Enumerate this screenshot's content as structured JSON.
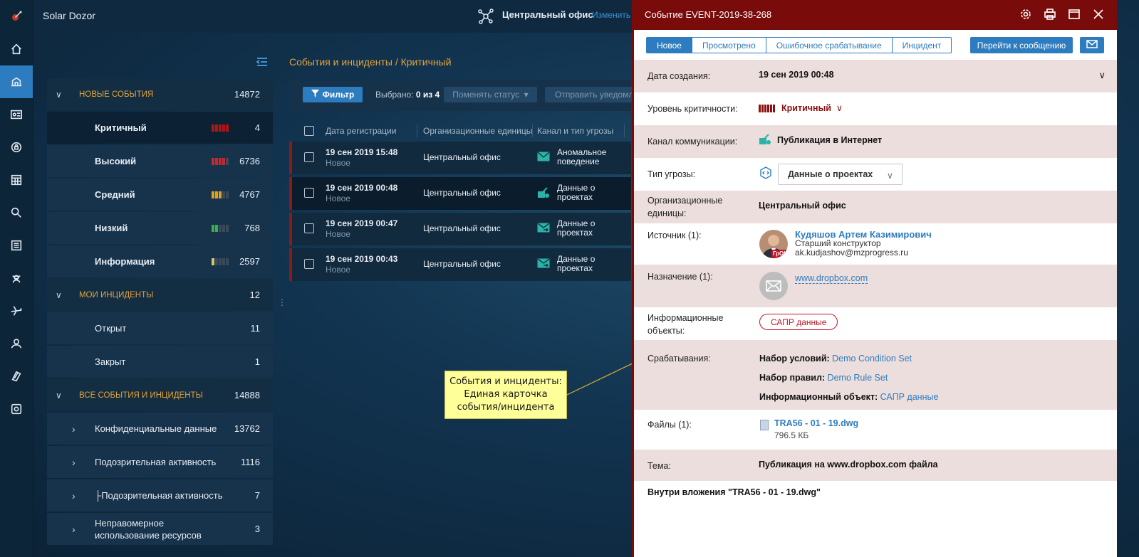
{
  "app": {
    "title": "Solar Dozor",
    "office": "Центральный офис",
    "change_label": "Изменить"
  },
  "sidebar_icons": [
    "home-icon",
    "dashboard-icon",
    "id-card-icon",
    "security-icon",
    "calendar-icon",
    "search-icon",
    "list-icon",
    "agent-icon",
    "plane-icon",
    "users-icon",
    "archive-icon",
    "settings-icon"
  ],
  "tree": {
    "new_events": {
      "label": "НОВЫЕ СОБЫТИЯ",
      "count": "14872",
      "items": [
        {
          "label": "Критичный",
          "count": "4"
        },
        {
          "label": "Высокий",
          "count": "6736"
        },
        {
          "label": "Средний",
          "count": "4767"
        },
        {
          "label": "Низкий",
          "count": "768"
        },
        {
          "label": "Информация",
          "count": "2597"
        }
      ]
    },
    "my_incidents": {
      "label": "МОИ ИНЦИДЕНТЫ",
      "count": "12",
      "items": [
        {
          "label": "Открыт",
          "count": "11"
        },
        {
          "label": "Закрыт",
          "count": "1"
        }
      ]
    },
    "all": {
      "label": "ВСЕ СОБЫТИЯ И ИНЦИДЕНТЫ",
      "count": "14888",
      "items": [
        {
          "label": "Конфиденциальные данные",
          "count": "13762"
        },
        {
          "label": "Подозрительная активность",
          "count": "1116"
        },
        {
          "label": "├Подозрительная активность",
          "count": "7"
        },
        {
          "label": "Неправомерное использование ресурсов",
          "count": "3"
        }
      ]
    }
  },
  "main": {
    "breadcrumb": "События и инциденты / Критичный",
    "filter_label": "Фильтр",
    "selected_label": "Выбрано:",
    "selected_value": "0 из 4",
    "change_status_label": "Поменять статус",
    "send_notify_label": "Отправить уведомление",
    "columns": [
      "Дата регистрации",
      "Организационные единицы",
      "Канал и тип угрозы"
    ],
    "rows": [
      {
        "date": "19 сен 2019 15:48",
        "status": "Новое",
        "org": "Центральный офис",
        "threat": "Аномальное поведение"
      },
      {
        "date": "19 сен 2019 00:48",
        "status": "Новое",
        "org": "Центральный офис",
        "threat": "Данные о проектах"
      },
      {
        "date": "19 сен 2019 00:47",
        "status": "Новое",
        "org": "Центральный офис",
        "threat": "Данные о проектах"
      },
      {
        "date": "19 сен 2019 00:43",
        "status": "Новое",
        "org": "Центральный офис",
        "threat": "Данные о проектах"
      }
    ]
  },
  "callout": {
    "line1": "События и инциденты:",
    "line2": "Единая карточка",
    "line3": "события/инцидента"
  },
  "panel": {
    "title": "Событие EVENT-2019-38-268",
    "tabs": [
      "Новое",
      "Просмотрено",
      "Ошибочное срабатывание",
      "Инцидент"
    ],
    "goto_label": "Перейти к сообщению",
    "created_label": "Дата создания:",
    "created_value": "19 сен 2019 00:48",
    "severity_label": "Уровень критичности:",
    "severity_value": "Критичный",
    "channel_label": "Канал коммуникации:",
    "channel_value": "Публикация в Интернет",
    "threat_label": "Тип угрозы:",
    "threat_value": "Данные о проектах",
    "org_label": "Организационные единицы:",
    "org_value": "Центральный офис",
    "source_label": "Источник (1):",
    "source_name": "Кудяшов Артем Казимирович",
    "source_role": "Старший конструктор",
    "source_email": "ak.kudjashov@mzprogress.ru",
    "source_badge": "ГрОК",
    "dest_label": "Назначение (1):",
    "dest_value": "www.dropbox.com",
    "info_label": "Информационные объекты:",
    "info_value": "САПР данные",
    "trig_label": "Срабатывания:",
    "cond_label": "Набор условий:",
    "cond_value": "Demo Condition Set",
    "rule_label": "Набор правил:",
    "rule_value": "Demo Rule Set",
    "obj_label": "Информационный объект:",
    "obj_value": "САПР данные",
    "files_label": "Файлы (1):",
    "file_name": "TRA56 - 01 - 19.dwg",
    "file_size": "796.5 КБ",
    "subject_label": "Тема:",
    "subject_value": "Публикация на www.dropbox.com файла",
    "attachment_label": "Внутри вложения \"TRA56 - 01 - 19.dwg\""
  },
  "colors": {
    "accent": "#2e7cc0",
    "critical": "#7a0b0b",
    "section": "#e2a23a"
  }
}
